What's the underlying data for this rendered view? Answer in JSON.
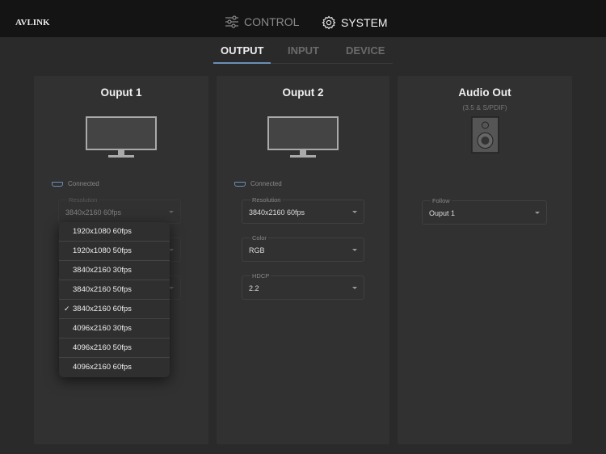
{
  "header": {
    "logo": "AVLINK",
    "nav": [
      {
        "label": "CONTROL",
        "icon": "sliders-icon",
        "active": false
      },
      {
        "label": "SYSTEM",
        "icon": "gear-icon",
        "active": true
      }
    ]
  },
  "tabs": [
    {
      "label": "OUTPUT",
      "active": true
    },
    {
      "label": "INPUT"
    },
    {
      "label": "DEVICE"
    }
  ],
  "accent": "#6b8fb8",
  "panels": {
    "output1": {
      "title": "Ouput 1",
      "status": "Connected",
      "resolution_label": "Resolution",
      "resolution": "3840x2160 60fps"
    },
    "output2": {
      "title": "Ouput 2",
      "status": "Connected",
      "resolution_label": "Resolution",
      "resolution": "3840x2160 60fps",
      "color_label": "Color",
      "color": "RGB",
      "hdcp_label": "HDCP",
      "hdcp": "2.2"
    },
    "audio": {
      "title": "Audio Out",
      "subtitle": "(3.5 & S/PDIF)",
      "follow_label": "Follow",
      "follow": "Ouput 1"
    }
  },
  "dropdown": {
    "selected": "3840x2160 60fps",
    "check": "✓",
    "options": [
      "1920x1080 60fps",
      "1920x1080 50fps",
      "3840x2160 30fps",
      "3840x2160 50fps",
      "3840x2160 60fps",
      "4096x2160 30fps",
      "4096x2160 50fps",
      "4096x2160 60fps"
    ]
  }
}
